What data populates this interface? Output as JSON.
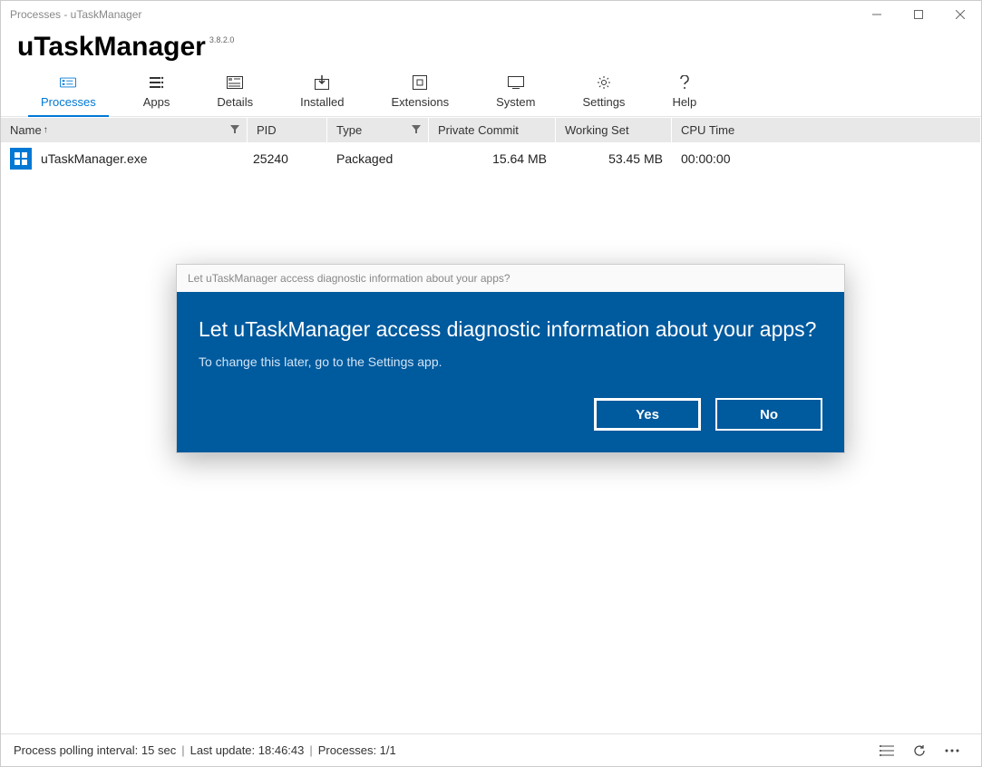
{
  "window": {
    "title": "Processes - uTaskManager"
  },
  "header": {
    "app_name": "uTaskManager",
    "version": "3.8.2.0"
  },
  "tabs": [
    {
      "label": "Processes",
      "active": true
    },
    {
      "label": "Apps"
    },
    {
      "label": "Details"
    },
    {
      "label": "Installed"
    },
    {
      "label": "Extensions"
    },
    {
      "label": "System"
    },
    {
      "label": "Settings"
    },
    {
      "label": "Help"
    }
  ],
  "table": {
    "columns": {
      "name": "Name",
      "pid": "PID",
      "type": "Type",
      "commit": "Private Commit",
      "ws": "Working Set",
      "cpu": "CPU Time"
    },
    "sort_indicator": "↑",
    "rows": [
      {
        "name": "uTaskManager.exe",
        "pid": "25240",
        "type": "Packaged",
        "commit": "15.64 MB",
        "ws": "53.45 MB",
        "cpu": "00:00:00"
      }
    ]
  },
  "status": {
    "polling": "Process polling interval: 15 sec",
    "last_update": "Last update: 18:46:43",
    "processes": "Processes: 1/1"
  },
  "dialog": {
    "titlebar": "Let uTaskManager access diagnostic information about your apps?",
    "heading": "Let uTaskManager access diagnostic information about your apps?",
    "sub": "To change this later, go to the Settings app.",
    "yes": "Yes",
    "no": "No"
  }
}
